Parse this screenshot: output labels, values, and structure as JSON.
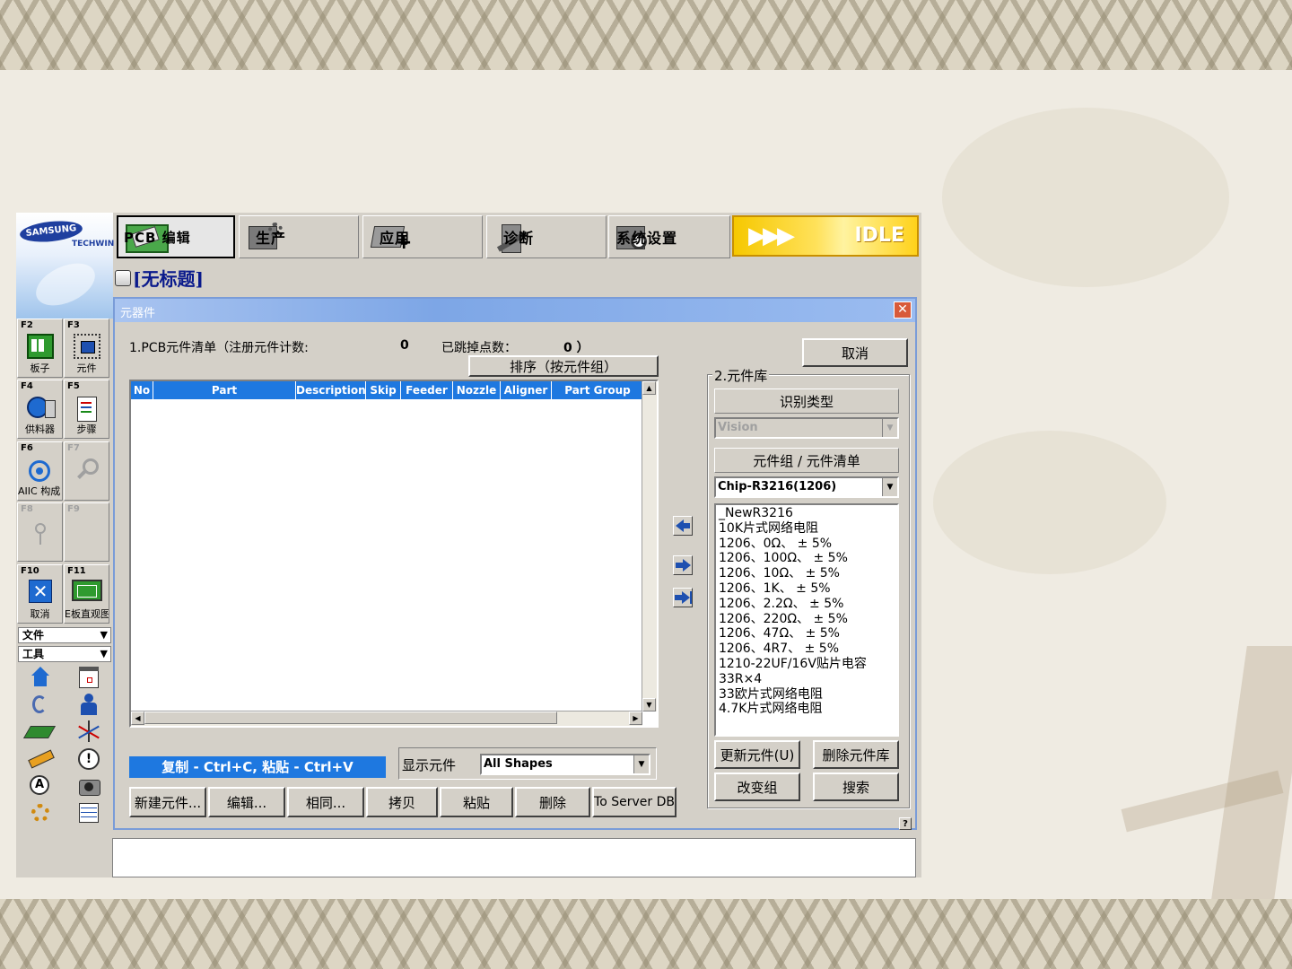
{
  "toolbar": {
    "tabs": [
      {
        "label": "PCB 编辑",
        "icon": "pcb-edit-icon",
        "active": true
      },
      {
        "label": "生产",
        "icon": "production-icon"
      },
      {
        "label": "应用",
        "icon": "application-icon"
      },
      {
        "label": "诊断",
        "icon": "diagnosis-icon"
      },
      {
        "label": "系统设置",
        "icon": "system-settings-icon"
      }
    ],
    "status_label": "IDLE"
  },
  "logo": {
    "brand": "SAMSUNG",
    "sub": "TECHWIN"
  },
  "fkeys": [
    {
      "key": "F2",
      "label": "板子",
      "icon": "board-icon"
    },
    {
      "key": "F3",
      "label": "元件",
      "icon": "component-icon"
    },
    {
      "key": "F4",
      "label": "供料器",
      "icon": "feeder-icon"
    },
    {
      "key": "F5",
      "label": "步骤",
      "icon": "steps-icon"
    },
    {
      "key": "F6",
      "label": "AIIC 构成",
      "icon": "aiic-icon"
    },
    {
      "key": "F7",
      "label": "",
      "icon": "search-icon"
    },
    {
      "key": "F8",
      "label": "",
      "icon": "pin-icon"
    },
    {
      "key": "F9",
      "label": ""
    },
    {
      "key": "F10",
      "label": "取消",
      "icon": "cancel-icon"
    },
    {
      "key": "F11",
      "label": "E板直观图",
      "icon": "board-view-icon"
    }
  ],
  "menus": {
    "file": "文件",
    "tools": "工具"
  },
  "document": {
    "title": "[无标题]"
  },
  "dialog": {
    "title": "元器件",
    "pcb_list_label": "1.PCB元件清单（注册元件计数:",
    "registered_count": "0",
    "skipped_label": "已跳掉点数：",
    "skipped_count": "0 ）",
    "sort_button": "排序（按元件组）",
    "cancel_button": "取消",
    "columns": [
      "No",
      "Part",
      "Description",
      "Skip",
      "Feeder",
      "Nozzle",
      "Aligner",
      "Part Group"
    ],
    "copy_paste_hint": "复制 - Ctrl+C, 粘贴 - Ctrl+V",
    "show_parts_label": "显示元件",
    "shape_filter": "All Shapes",
    "actions": [
      "新建元件...",
      "编辑...",
      "相同...",
      "拷贝",
      "粘贴",
      "删除",
      "To Server DB"
    ],
    "library": {
      "title": "2.元件库",
      "recognition_button": "识别类型",
      "recognition_value": "Vision",
      "group_button": "元件组 / 元件清单",
      "group_value": "Chip-R3216(1206)",
      "items": [
        "_NewR3216",
        "10K片式网络电阻",
        "1206、0Ω、 ± 5%",
        "1206、100Ω、 ± 5%",
        "1206、10Ω、 ± 5%",
        "1206、1K、 ± 5%",
        "1206、2.2Ω、 ± 5%",
        "1206、220Ω、 ± 5%",
        "1206、47Ω、 ± 5%",
        "1206、4R7、 ± 5%",
        "1210-22UF/16V贴片电容",
        "33R×4",
        "33欧片式网络电阻",
        "4.7K片式网络电阻"
      ],
      "update_button": "更新元件(U)",
      "delete_button": "删除元件库",
      "change_group_button": "改变组",
      "search_button": "搜索"
    },
    "help": "?"
  }
}
